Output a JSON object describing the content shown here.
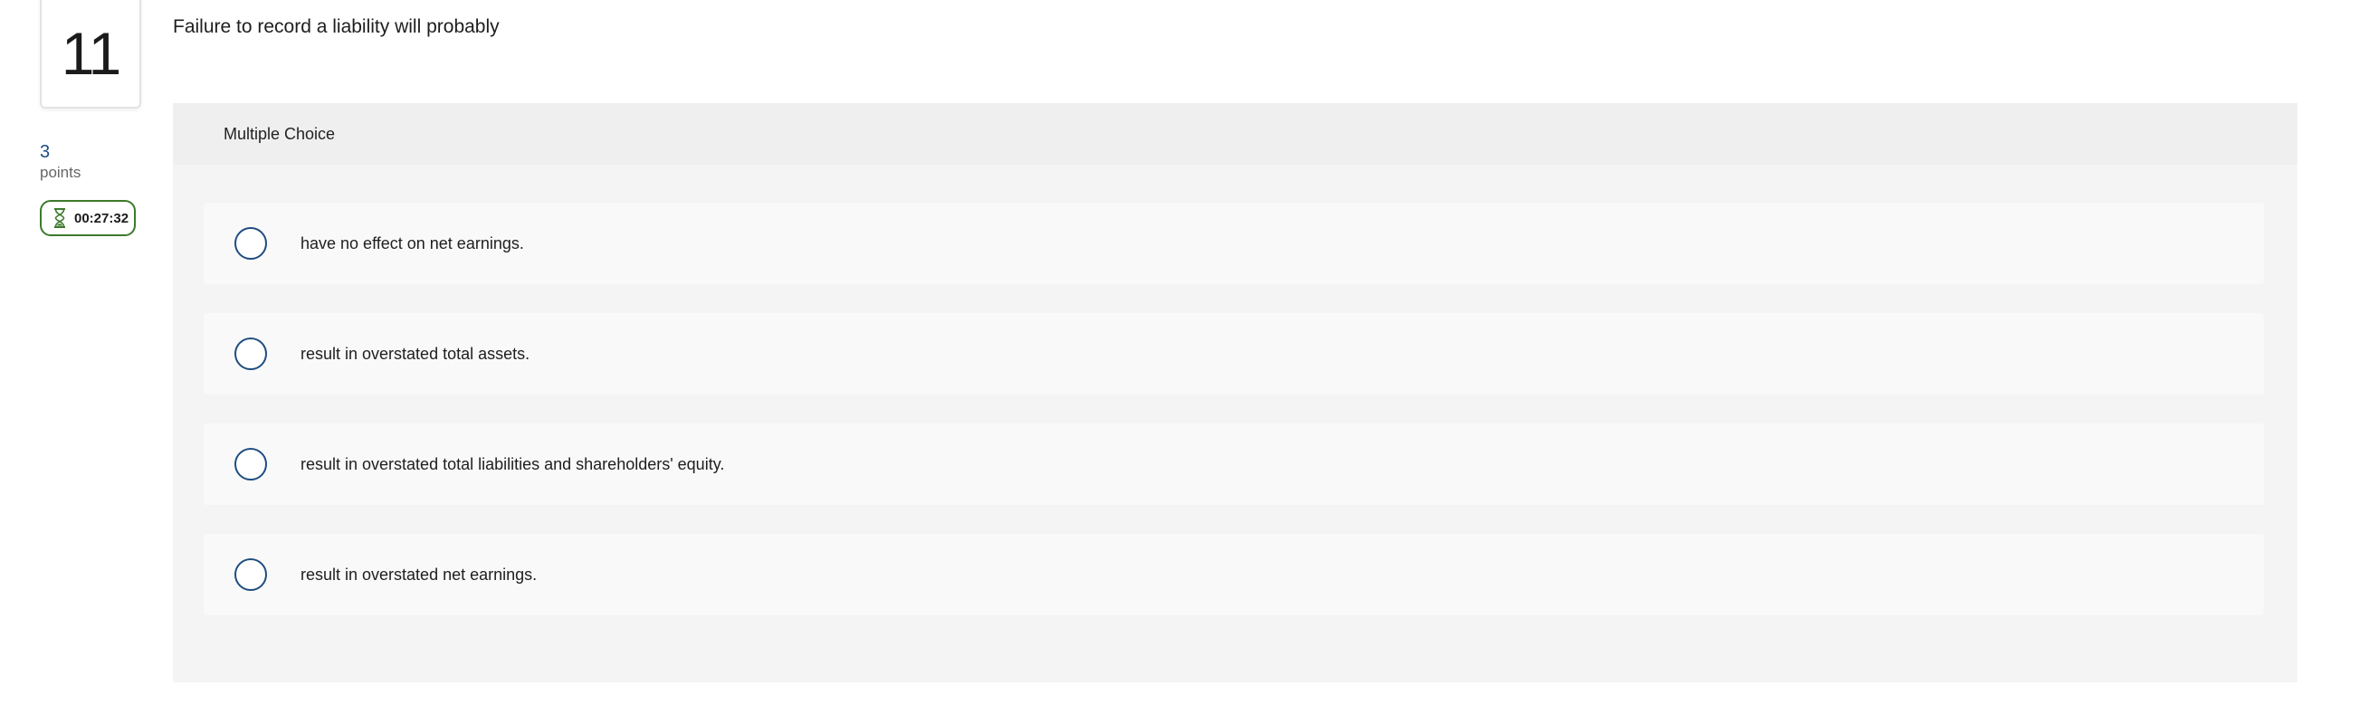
{
  "question": {
    "number": "11",
    "text": "Failure to record a liability will probably",
    "points_value": "3",
    "points_label": "points",
    "timer": "00:27:32",
    "timer_icon": "hourglass-icon"
  },
  "multiple_choice": {
    "header": "Multiple Choice",
    "options": [
      {
        "label": "have no effect on net earnings."
      },
      {
        "label": "result in overstated total assets."
      },
      {
        "label": "result in overstated total liabilities and shareholders' equity."
      },
      {
        "label": "result in overstated net earnings."
      }
    ]
  },
  "colors": {
    "radio_border": "#1f4d80",
    "timer_border": "#3d7a2c",
    "panel_bg": "#f4f4f4",
    "option_bg": "#f9f9f9"
  }
}
